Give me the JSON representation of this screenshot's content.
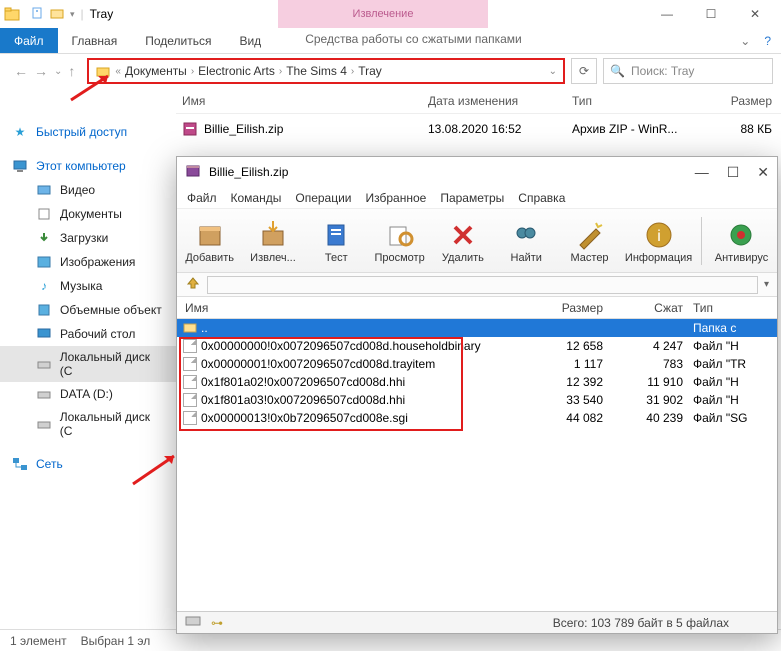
{
  "explorer": {
    "window_title": "Tray",
    "context_header": "Извлечение",
    "tabs": {
      "file": "Файл",
      "home": "Главная",
      "share": "Поделиться",
      "view": "Вид",
      "context": "Средства работы со сжатыми папками"
    },
    "breadcrumb": [
      "Документы",
      "Electronic Arts",
      "The Sims 4",
      "Tray"
    ],
    "search_placeholder": "Поиск: Tray",
    "columns": {
      "name": "Имя",
      "date": "Дата изменения",
      "type": "Тип",
      "size": "Размер"
    },
    "files": [
      {
        "name": "Billie_Eilish.zip",
        "date": "13.08.2020 16:52",
        "type": "Архив ZIP - WinR...",
        "size": "88 КБ"
      }
    ],
    "status": {
      "count": "1 элемент",
      "selected": "Выбран 1 эл"
    }
  },
  "sidebar": {
    "quick": "Быстрый доступ",
    "thispc": "Этот компьютер",
    "items": [
      "Видео",
      "Документы",
      "Загрузки",
      "Изображения",
      "Музыка",
      "Объемные объект",
      "Рабочий стол",
      "Локальный диск (С",
      "DATA (D:)",
      "Локальный диск (С"
    ],
    "network": "Сеть"
  },
  "winrar": {
    "title": "Billie_Eilish.zip",
    "menus": [
      "Файл",
      "Команды",
      "Операции",
      "Избранное",
      "Параметры",
      "Справка"
    ],
    "tools": [
      "Добавить",
      "Извлеч...",
      "Тест",
      "Просмотр",
      "Удалить",
      "Найти",
      "Мастер",
      "Информация",
      "Антивирус"
    ],
    "columns": {
      "name": "Имя",
      "size": "Размер",
      "packed": "Сжат",
      "type": "Тип"
    },
    "parent": {
      "name": "..",
      "type": "Папка с"
    },
    "files": [
      {
        "name": "0x00000000!0x0072096507cd008d.householdbinary",
        "size": "12 658",
        "packed": "4 247",
        "type": "Файл \"H"
      },
      {
        "name": "0x00000001!0x0072096507cd008d.trayitem",
        "size": "1 117",
        "packed": "783",
        "type": "Файл \"TR"
      },
      {
        "name": "0x1f801a02!0x0072096507cd008d.hhi",
        "size": "12 392",
        "packed": "11 910",
        "type": "Файл \"H"
      },
      {
        "name": "0x1f801a03!0x0072096507cd008d.hhi",
        "size": "33 540",
        "packed": "31 902",
        "type": "Файл \"H"
      },
      {
        "name": "0x00000013!0x0b72096507cd008e.sgi",
        "size": "44 082",
        "packed": "40 239",
        "type": "Файл \"SG"
      }
    ],
    "status_total": "Всего: 103 789 байт в 5 файлах"
  }
}
